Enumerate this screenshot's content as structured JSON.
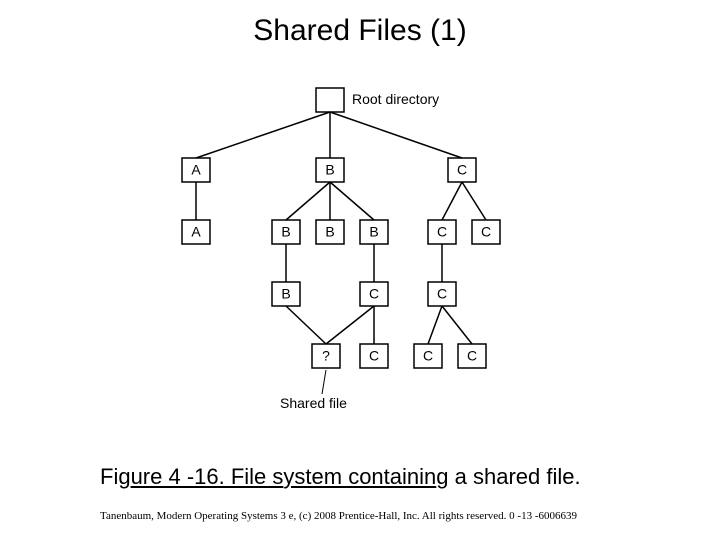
{
  "title": "Shared Files (1)",
  "captionA": "Fig",
  "captionB": "ure 4 -16. File s",
  "captionC": "ystem containin",
  "captionD": "g",
  "captionE": " a shared file.",
  "credit": "Tanenbaum, Modern Operating Systems 3 e, (c) 2008 Prentice-Hall, Inc. All rights reserved. 0 -13 -6006639",
  "diagram": {
    "rootLabel": "Root directory",
    "sharedLabel": "Shared file",
    "row1": {
      "a": "A",
      "b": "B",
      "c": "C"
    },
    "row2": {
      "a": "A",
      "b1": "B",
      "b2": "B",
      "b3": "B",
      "c1": "C",
      "c2": "C"
    },
    "row3": {
      "b": "B",
      "c": "C",
      "c2": "C"
    },
    "row4": {
      "q": "?",
      "c1": "C",
      "c2": "C",
      "c3": "C"
    }
  }
}
